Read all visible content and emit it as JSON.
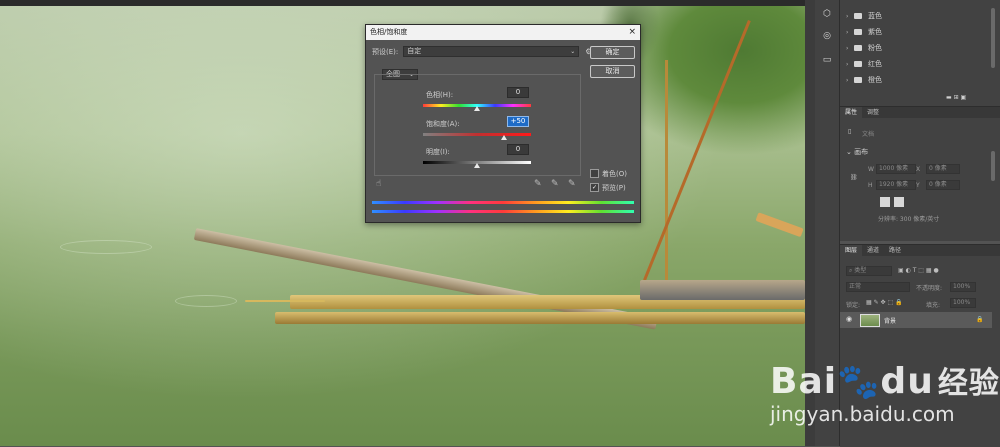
{
  "dialog": {
    "title": "色相/饱和度",
    "close": "×",
    "preset_label": "预设(E):",
    "preset_value": "自定",
    "ok_label": "确定",
    "cancel_label": "取消",
    "channel_value": "全图",
    "hue_label": "色相(H):",
    "hue_value": "0",
    "saturation_label": "饱和度(A):",
    "saturation_value": "+50",
    "lightness_label": "明度(I):",
    "lightness_value": "0",
    "colorize_label": "着色(O)",
    "colorize_checked": false,
    "preview_label": "预览(P)",
    "preview_checked": true,
    "slider_positions": {
      "hue": 0.5,
      "saturation": 0.75,
      "lightness": 0.5
    }
  },
  "layers_top": {
    "items": [
      "蓝色",
      "紫色",
      "粉色",
      "红色",
      "橙色"
    ]
  },
  "properties": {
    "tabs": [
      "属性",
      "调整"
    ],
    "doc_label": "文档",
    "section": "画布",
    "w_label": "W",
    "w_value": "1000 像素",
    "h_label": "H",
    "h_value": "1920 像素",
    "x_label": "X",
    "x_value": "0 像素",
    "y_label": "Y",
    "y_value": "0 像素",
    "resolution": "分辨率: 300 像素/英寸"
  },
  "layers_panel": {
    "tabs": [
      "图层",
      "通道",
      "路径"
    ],
    "kind_label": "类型",
    "blend_mode": "正常",
    "opacity_label": "不透明度:",
    "opacity_value": "100%",
    "lock_label": "锁定:",
    "fill_label": "填充:",
    "fill_value": "100%",
    "layer_name": "背景"
  },
  "watermark": {
    "brand": "Bai",
    "brand2": "du",
    "suffix": "经验",
    "url": "jingyan.baidu.com"
  },
  "icons": {
    "close": "close-icon",
    "gear": "gear-icon",
    "hand": "hand-target-icon",
    "eyedropper": "eyedropper-icon",
    "eye": "eye-icon",
    "lock": "lock-icon",
    "folder": "folder-icon"
  },
  "colors": {
    "selection": "#1e6bc6",
    "dialog_bg": "#535353",
    "panel_bg": "#424242"
  }
}
